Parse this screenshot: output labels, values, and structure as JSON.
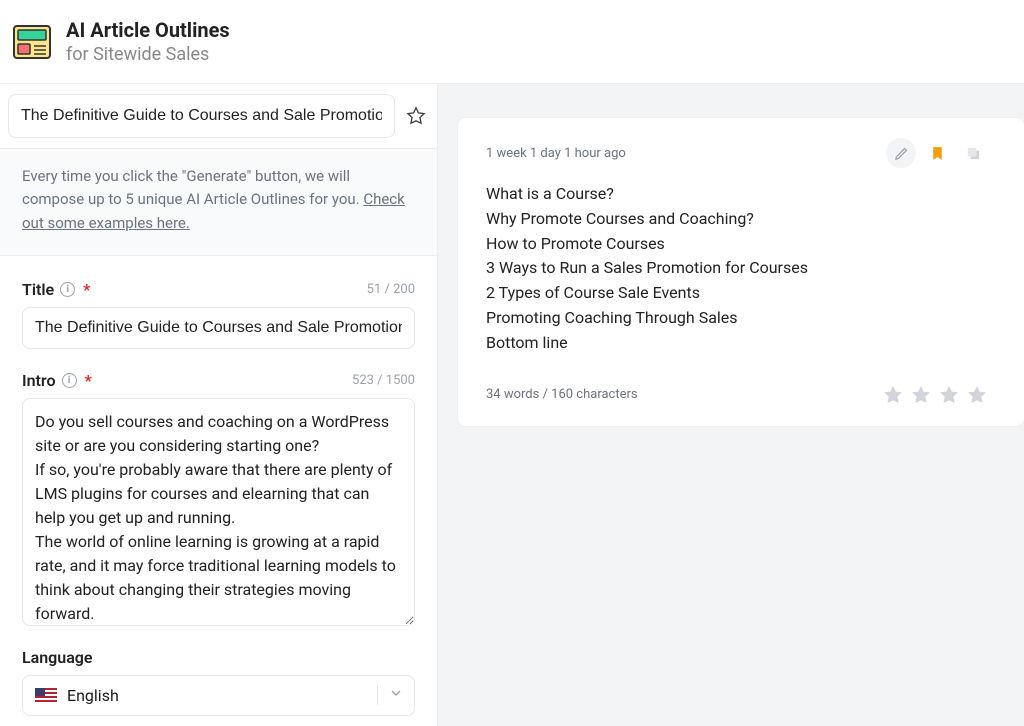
{
  "header": {
    "title": "AI Article Outlines",
    "subtitle": "for Sitewide Sales"
  },
  "docname": {
    "value": "The Definitive Guide to Courses and Sale Promotions"
  },
  "info": {
    "text_prefix": "Every time you click the \"Generate\" button, we will compose up to 5 unique AI Article Outlines for you. ",
    "link_text": "Check out some examples here."
  },
  "form": {
    "title": {
      "label": "Title",
      "required": "*",
      "counter": "51 / 200",
      "value": "The Definitive Guide to Courses and Sale Promotions"
    },
    "intro": {
      "label": "Intro",
      "required": "*",
      "counter": "523 / 1500",
      "value": "Do you sell courses and coaching on a WordPress site or are you considering starting one?\nIf so, you're probably aware that there are plenty of LMS plugins for courses and elearning that can help you get up and running.\nThe world of online learning is growing at a rapid rate, and it may force traditional learning models to think about changing their strategies moving forward.\nIf you're a course creator looking to sell more"
    },
    "language": {
      "label": "Language",
      "value": "English"
    }
  },
  "result": {
    "time": "1 week 1 day 1 hour ago",
    "lines": [
      "What is a Course?",
      "Why Promote Courses and Coaching?",
      "How to Promote Courses",
      "3 Ways to Run a Sales Promotion for Courses",
      "2 Types of Course Sale Events",
      "Promoting Coaching Through Sales",
      "Bottom line"
    ],
    "stats": "34 words / 160 characters"
  }
}
